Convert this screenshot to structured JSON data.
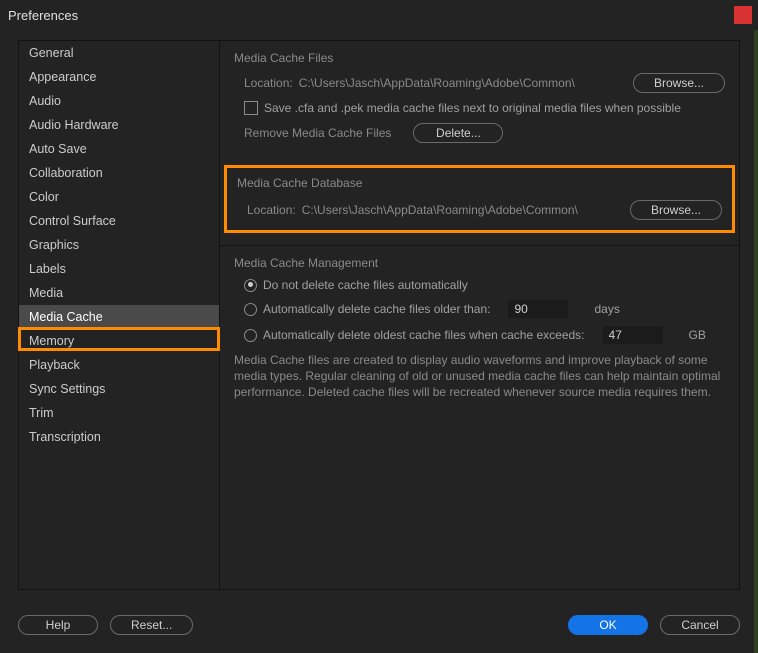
{
  "window": {
    "title": "Preferences"
  },
  "sidebar": {
    "items": [
      {
        "label": "General"
      },
      {
        "label": "Appearance"
      },
      {
        "label": "Audio"
      },
      {
        "label": "Audio Hardware"
      },
      {
        "label": "Auto Save"
      },
      {
        "label": "Collaboration"
      },
      {
        "label": "Color"
      },
      {
        "label": "Control Surface"
      },
      {
        "label": "Graphics"
      },
      {
        "label": "Labels"
      },
      {
        "label": "Media"
      },
      {
        "label": "Media Cache"
      },
      {
        "label": "Memory"
      },
      {
        "label": "Playback"
      },
      {
        "label": "Sync Settings"
      },
      {
        "label": "Trim"
      },
      {
        "label": "Transcription"
      }
    ],
    "selected": "Media Cache"
  },
  "cacheFiles": {
    "heading": "Media Cache Files",
    "locationLabel": "Location:",
    "locationValue": "C:\\Users\\Jasch\\AppData\\Roaming\\Adobe\\Common\\",
    "browse": "Browse...",
    "saveNext": "Save .cfa and .pek media cache files next to original media files when possible",
    "removeLabel": "Remove Media Cache Files",
    "delete": "Delete..."
  },
  "cacheDb": {
    "heading": "Media Cache Database",
    "locationLabel": "Location:",
    "locationValue": "C:\\Users\\Jasch\\AppData\\Roaming\\Adobe\\Common\\",
    "browse": "Browse..."
  },
  "cacheMgmt": {
    "heading": "Media Cache Management",
    "opt1": "Do not delete cache files automatically",
    "opt2": "Automatically delete cache files older than:",
    "opt2Value": "90",
    "opt2Unit": "days",
    "opt3": "Automatically delete oldest cache files when cache exceeds:",
    "opt3Value": "47",
    "opt3Unit": "GB",
    "info": "Media Cache files are created to display audio waveforms and improve playback of some media types.  Regular cleaning of old or unused media cache files can help maintain optimal performance. Deleted cache files will be recreated whenever source media requires them."
  },
  "footer": {
    "help": "Help",
    "reset": "Reset...",
    "ok": "OK",
    "cancel": "Cancel"
  }
}
